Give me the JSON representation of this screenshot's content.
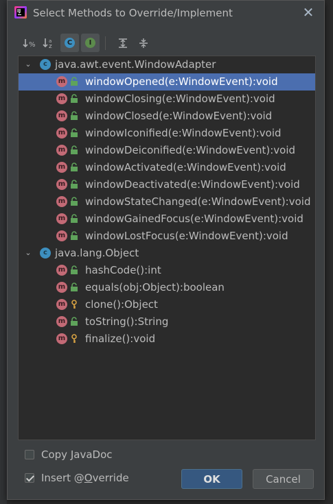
{
  "dialog": {
    "title": "Select Methods to Override/Implement",
    "close_glyph": "✕"
  },
  "toolbar": {
    "buttons": [
      {
        "name": "sort-by-visibility-icon",
        "glyph": "↓%"
      },
      {
        "name": "sort-alphabetically-icon",
        "glyph": "↓ᵃz"
      },
      {
        "name": "show-classes-icon",
        "glyph": "C",
        "active": true
      },
      {
        "name": "show-interfaces-icon",
        "glyph": "I",
        "active": true
      },
      {
        "name": "expand-all-icon",
        "glyph": "≡"
      },
      {
        "name": "collapse-all-icon",
        "glyph": "≡"
      }
    ]
  },
  "tree": {
    "groups": [
      {
        "name": "java.awt.event.WindowAdapter",
        "methods": [
          {
            "label": "windowOpened(e:WindowEvent):void",
            "access": "public",
            "selected": true
          },
          {
            "label": "windowClosing(e:WindowEvent):void",
            "access": "public"
          },
          {
            "label": "windowClosed(e:WindowEvent):void",
            "access": "public"
          },
          {
            "label": "windowIconified(e:WindowEvent):void",
            "access": "public"
          },
          {
            "label": "windowDeiconified(e:WindowEvent):void",
            "access": "public"
          },
          {
            "label": "windowActivated(e:WindowEvent):void",
            "access": "public"
          },
          {
            "label": "windowDeactivated(e:WindowEvent):void",
            "access": "public"
          },
          {
            "label": "windowStateChanged(e:WindowEvent):void",
            "access": "public"
          },
          {
            "label": "windowGainedFocus(e:WindowEvent):void",
            "access": "public"
          },
          {
            "label": "windowLostFocus(e:WindowEvent):void",
            "access": "public"
          }
        ]
      },
      {
        "name": "java.lang.Object",
        "methods": [
          {
            "label": "hashCode():int",
            "access": "public"
          },
          {
            "label": "equals(obj:Object):boolean",
            "access": "public"
          },
          {
            "label": "clone():Object",
            "access": "protected"
          },
          {
            "label": "toString():String",
            "access": "public"
          },
          {
            "label": "finalize():void",
            "access": "protected"
          }
        ]
      }
    ]
  },
  "options": {
    "copy_javadoc": {
      "label_pre": "Copy ",
      "label_u": "J",
      "label_post": "avaDoc",
      "checked": false
    },
    "insert_override": {
      "label_pre": "Insert @",
      "label_u": "O",
      "label_post": "verride",
      "checked": true
    }
  },
  "buttons": {
    "ok": "OK",
    "cancel": "Cancel"
  },
  "colors": {
    "selection": "#4b6eaf",
    "class_icon": "#3d8fbf",
    "method_icon": "#c36a76",
    "public_lock": "#5fa35b",
    "protected_key": "#d9a343"
  }
}
